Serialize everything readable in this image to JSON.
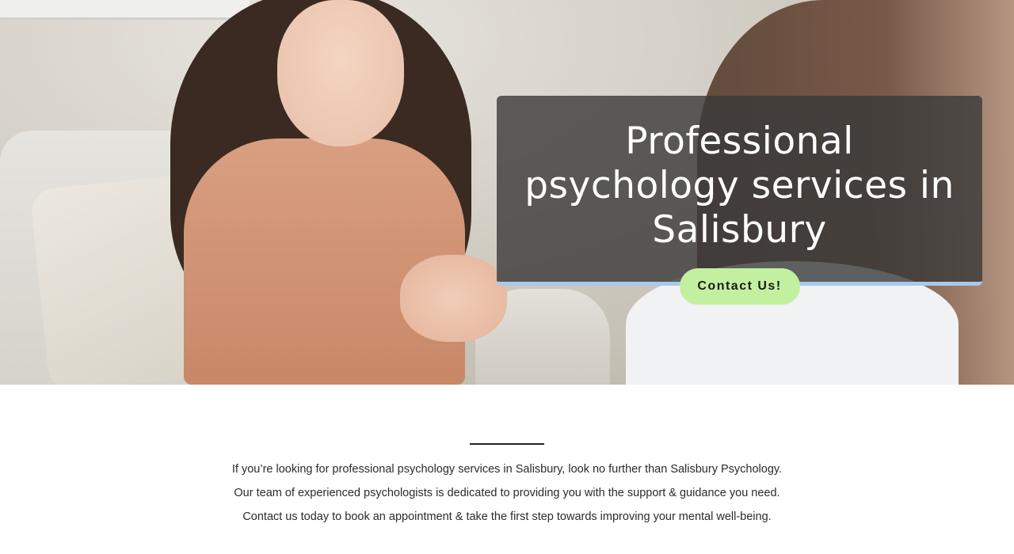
{
  "hero": {
    "title": "Professional psychology services in Salisbury",
    "cta_label": "Contact Us!",
    "overlay_color": "#3a3a3a",
    "accent_border_color": "#a9c9e8",
    "cta_color": "#c3f0a0"
  },
  "intro": {
    "text": "If you’re looking for professional psychology services in Salisbury, look no further than Salisbury Psychology. Our team of experienced psychologists is dedicated to providing you with the support & guidance you need. Contact us today to book an appointment & take the first step towards improving your mental well-being."
  }
}
